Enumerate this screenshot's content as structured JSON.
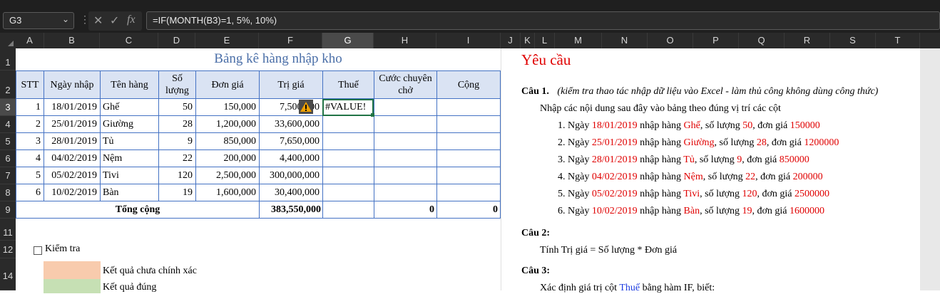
{
  "formula_bar": {
    "name_box": "G3",
    "formula": "=IF(MONTH(B3)=1, 5%, 10%)",
    "fx_label": "fx"
  },
  "columns": [
    "A",
    "B",
    "C",
    "D",
    "E",
    "F",
    "G",
    "H",
    "I",
    "J",
    "K",
    "L",
    "M",
    "N",
    "O",
    "P",
    "Q",
    "R",
    "S",
    "T"
  ],
  "rows": [
    "1",
    "2",
    "3",
    "4",
    "5",
    "6",
    "7",
    "8",
    "9",
    "11",
    "12",
    "14"
  ],
  "sheet": {
    "title": "Bảng kê hàng nhập kho",
    "headers": {
      "stt": "STT",
      "ngay_nhap": "Ngày nhập",
      "ten_hang": "Tên hàng",
      "so_luong": "Số lượng",
      "don_gia": "Đơn giá",
      "tri_gia": "Trị giá",
      "thue": "Thuế",
      "cuoc": "Cước chuyên chở",
      "cong": "Cộng"
    },
    "data_rows": [
      {
        "stt": "1",
        "date": "18/01/2019",
        "item": "Ghế",
        "qty": "50",
        "price": "150,000",
        "value": "7,500,000",
        "tax": "#VALUE!"
      },
      {
        "stt": "2",
        "date": "25/01/2019",
        "item": "Giường",
        "qty": "28",
        "price": "1,200,000",
        "value": "33,600,000",
        "tax": ""
      },
      {
        "stt": "3",
        "date": "28/01/2019",
        "item": "Tủ",
        "qty": "9",
        "price": "850,000",
        "value": "7,650,000",
        "tax": ""
      },
      {
        "stt": "4",
        "date": "04/02/2019",
        "item": "Nệm",
        "qty": "22",
        "price": "200,000",
        "value": "4,400,000",
        "tax": ""
      },
      {
        "stt": "5",
        "date": "05/02/2019",
        "item": "Tivi",
        "qty": "120",
        "price": "2,500,000",
        "value": "300,000,000",
        "tax": ""
      },
      {
        "stt": "6",
        "date": "10/02/2019",
        "item": "Bàn",
        "qty": "19",
        "price": "1,600,000",
        "value": "30,400,000",
        "tax": ""
      }
    ],
    "total_label": "Tổng cộng",
    "total_value": "383,550,000",
    "total_cuoc": "0",
    "total_cong": "0",
    "check_label": "Kiểm tra",
    "legend_wrong": "Kết quả chưa chính xác",
    "legend_right": "Kết quả đúng"
  },
  "requirements": {
    "heading": "Yêu cầu",
    "q1_label": "Câu 1.",
    "q1_note": "(kiểm tra thao tác nhập dữ liệu vào Excel - làm thủ công không dùng công thức)",
    "q1_instruction": "Nhập các nội dung sau đây vào bảng theo đúng vị trí các cột",
    "items": [
      {
        "n": "1. Ngày ",
        "date": "18/01/2019",
        "m1": " nhập hàng ",
        "item": "Ghế",
        "m2": ", số lượng ",
        "qty": "50",
        "m3": ", đơn giá ",
        "price": "150000"
      },
      {
        "n": "2. Ngày ",
        "date": "25/01/2019",
        "m1": " nhập hàng ",
        "item": "Giường",
        "m2": ", số lượng ",
        "qty": "28",
        "m3": ", đơn giá ",
        "price": "1200000"
      },
      {
        "n": "3. Ngày ",
        "date": "28/01/2019",
        "m1": " nhập hàng ",
        "item": "Tủ",
        "m2": ", số lượng ",
        "qty": "9",
        "m3": ", đơn giá ",
        "price": "850000"
      },
      {
        "n": "4. Ngày ",
        "date": "04/02/2019",
        "m1": " nhập hàng ",
        "item": "Nệm",
        "m2": ", số lượng ",
        "qty": "22",
        "m3": ", đơn giá ",
        "price": "200000"
      },
      {
        "n": "5. Ngày ",
        "date": "05/02/2019",
        "m1": " nhập hàng ",
        "item": "Tivi",
        "m2": ", số lượng ",
        "qty": "120",
        "m3": ", đơn giá ",
        "price": "2500000"
      },
      {
        "n": "6. Ngày ",
        "date": "10/02/2019",
        "m1": " nhập hàng ",
        "item": "Bàn",
        "m2": ", số lượng ",
        "qty": "19",
        "m3": ", đơn giá ",
        "price": "1600000"
      }
    ],
    "q2_label": "Câu 2:",
    "q2_text": "Tính Trị giá = Số lượng * Đơn giá",
    "q3_label": "Câu 3:",
    "q3_text_a": "Xác định giá trị cột ",
    "q3_text_b": "Thuế",
    "q3_text_c": " bằng hàm IF, biết:"
  },
  "colors": {
    "header_fill": "#dae3f3",
    "border_blue": "#4472c4",
    "title_blue": "#4b6fa8",
    "error_red": "#e00000",
    "legend_wrong": "#f8cbad",
    "legend_right": "#c6e0b4"
  }
}
